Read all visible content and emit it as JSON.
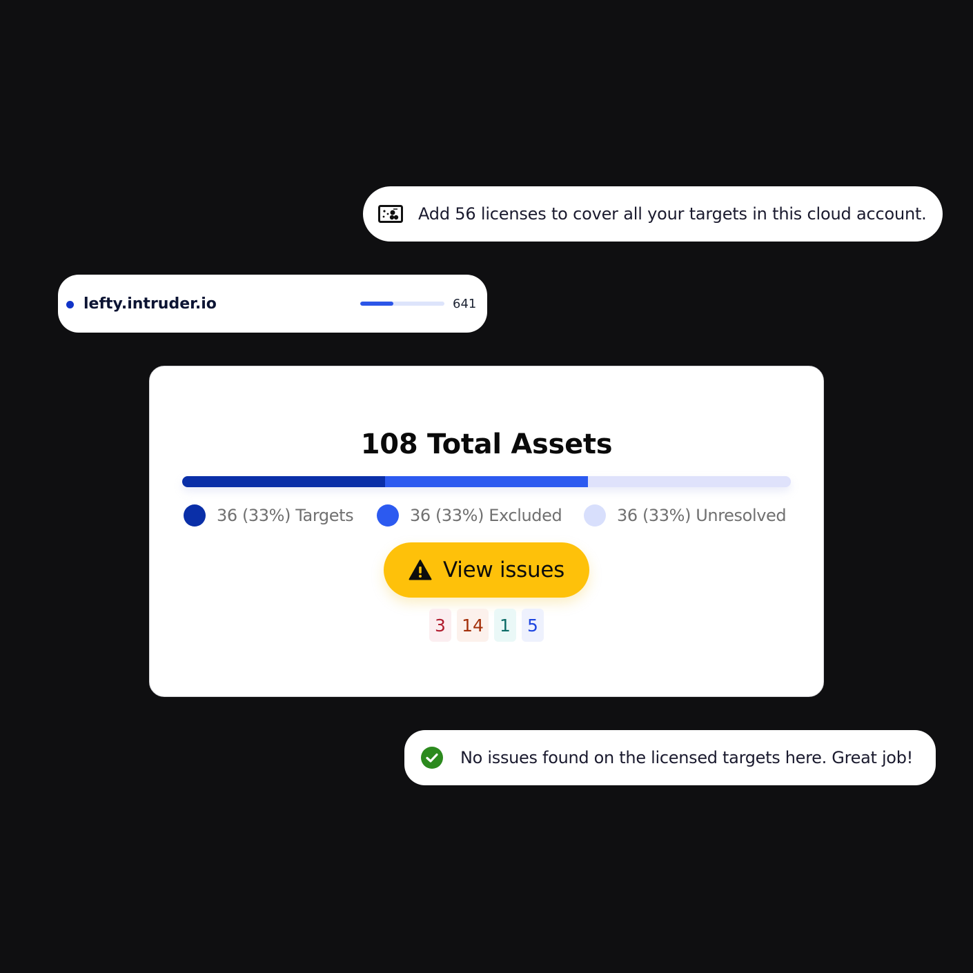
{
  "license_toast": {
    "icon": "ticket-icon",
    "text": "Add 56 licenses to cover all your targets in this cloud account."
  },
  "target_row": {
    "name": "lefty.intruder.io",
    "count": "641",
    "progress_fraction": 0.39,
    "dot_color": "#1134c8",
    "bar_color": "#2c56e8"
  },
  "assets": {
    "title": "108 Total Assets",
    "segments": [
      {
        "label": "36 (33%) Targets",
        "fraction": 0.3333,
        "color": "#0a2fa8"
      },
      {
        "label": "36 (33%) Excluded",
        "fraction": 0.3333,
        "color": "#2c5af0"
      },
      {
        "label": "36 (33%) Unresolved",
        "fraction": 0.3334,
        "color": "#dfe2fb"
      }
    ],
    "legend_dot_colors": [
      "#0a2fa8",
      "#2c5af0",
      "#d8dffc"
    ],
    "button_label": "View issues",
    "button_icon": "warning-icon",
    "button_color": "#fec10a",
    "severity_counts": [
      {
        "value": "3",
        "color": "#b01c2e",
        "background": "#fbeef0"
      },
      {
        "value": "14",
        "color": "#a3300a",
        "background": "#fcf1ec"
      },
      {
        "value": "1",
        "color": "#0b6b66",
        "background": "#eaf8f7"
      },
      {
        "value": "5",
        "color": "#1d45e0",
        "background": "#eef1fd"
      }
    ]
  },
  "success_toast": {
    "icon": "check-circle-icon",
    "icon_color": "#2c8a1e",
    "text": "No issues found on the licensed targets here. Great job!"
  }
}
